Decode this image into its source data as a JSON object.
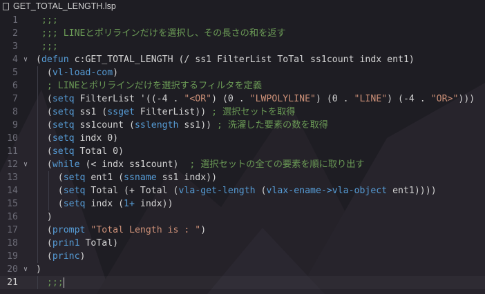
{
  "tab": {
    "filename": "GET_TOTAL_LENGTH.lsp",
    "icon": "file-icon"
  },
  "colors": {
    "background": "#1e1d23",
    "keyword": "#569cd6",
    "string": "#ce9178",
    "comment": "#6a9955",
    "text": "#d4d4d4"
  },
  "lines": [
    {
      "n": "1",
      "fold": false,
      "current": false,
      "tokens": [
        {
          "t": " ;;;",
          "c": "cm"
        }
      ]
    },
    {
      "n": "2",
      "fold": false,
      "current": false,
      "tokens": [
        {
          "t": " ;;; LINEとポリラインだけを選択し、その長さの和を返す",
          "c": "cm"
        }
      ]
    },
    {
      "n": "3",
      "fold": false,
      "current": false,
      "tokens": [
        {
          "t": " ;;;",
          "c": "cm"
        }
      ]
    },
    {
      "n": "4",
      "fold": true,
      "current": false,
      "tokens": [
        {
          "t": "(",
          "c": "par"
        },
        {
          "t": "defun",
          "c": "kw"
        },
        {
          "t": " c:GET_TOTAL_LENGTH (/ ss1 FilterList ToTal ss1count indx ent1)",
          "c": "par"
        }
      ]
    },
    {
      "n": "5",
      "fold": false,
      "current": false,
      "tokens": [
        {
          "t": "  (",
          "c": "par"
        },
        {
          "t": "vl-load-com",
          "c": "kw"
        },
        {
          "t": ")",
          "c": "par"
        }
      ]
    },
    {
      "n": "6",
      "fold": false,
      "current": false,
      "tokens": [
        {
          "t": "  ; LINEとポリラインだけを選択するフィルタを定義",
          "c": "cm"
        }
      ]
    },
    {
      "n": "7",
      "fold": false,
      "current": false,
      "tokens": [
        {
          "t": "  (",
          "c": "par"
        },
        {
          "t": "setq",
          "c": "kw"
        },
        {
          "t": " FilterList '((-4 . ",
          "c": "par"
        },
        {
          "t": "\"<OR\"",
          "c": "str"
        },
        {
          "t": ") (0 . ",
          "c": "par"
        },
        {
          "t": "\"LWPOLYLINE\"",
          "c": "str"
        },
        {
          "t": ") (0 . ",
          "c": "par"
        },
        {
          "t": "\"LINE\"",
          "c": "str"
        },
        {
          "t": ") (-4 . ",
          "c": "par"
        },
        {
          "t": "\"OR>\"",
          "c": "str"
        },
        {
          "t": ")))",
          "c": "par"
        }
      ]
    },
    {
      "n": "8",
      "fold": false,
      "current": false,
      "tokens": [
        {
          "t": "  (",
          "c": "par"
        },
        {
          "t": "setq",
          "c": "kw"
        },
        {
          "t": " ss1 (",
          "c": "par"
        },
        {
          "t": "ssget",
          "c": "kw"
        },
        {
          "t": " FilterList)) ",
          "c": "par"
        },
        {
          "t": "; 選択セットを取得",
          "c": "cm"
        }
      ]
    },
    {
      "n": "9",
      "fold": false,
      "current": false,
      "tokens": [
        {
          "t": "  (",
          "c": "par"
        },
        {
          "t": "setq",
          "c": "kw"
        },
        {
          "t": " ss1count (",
          "c": "par"
        },
        {
          "t": "sslength",
          "c": "kw"
        },
        {
          "t": " ss1)) ",
          "c": "par"
        },
        {
          "t": "; 洗濯した要素の数を取得",
          "c": "cm"
        }
      ]
    },
    {
      "n": "10",
      "fold": false,
      "current": false,
      "tokens": [
        {
          "t": "  (",
          "c": "par"
        },
        {
          "t": "setq",
          "c": "kw"
        },
        {
          "t": " indx 0)",
          "c": "par"
        }
      ]
    },
    {
      "n": "11",
      "fold": false,
      "current": false,
      "tokens": [
        {
          "t": "  (",
          "c": "par"
        },
        {
          "t": "setq",
          "c": "kw"
        },
        {
          "t": " Total 0)",
          "c": "par"
        }
      ]
    },
    {
      "n": "12",
      "fold": true,
      "current": false,
      "tokens": [
        {
          "t": "  (",
          "c": "par"
        },
        {
          "t": "while",
          "c": "kw"
        },
        {
          "t": " (< indx ss1count)  ",
          "c": "par"
        },
        {
          "t": "; 選択セットの全ての要素を順に取り出す",
          "c": "cm"
        }
      ]
    },
    {
      "n": "13",
      "fold": false,
      "current": false,
      "tokens": [
        {
          "t": "    (",
          "c": "par"
        },
        {
          "t": "setq",
          "c": "kw"
        },
        {
          "t": " ent1 (",
          "c": "par"
        },
        {
          "t": "ssname",
          "c": "kw"
        },
        {
          "t": " ss1 indx))",
          "c": "par"
        }
      ]
    },
    {
      "n": "14",
      "fold": false,
      "current": false,
      "tokens": [
        {
          "t": "    (",
          "c": "par"
        },
        {
          "t": "setq",
          "c": "kw"
        },
        {
          "t": " Total (+ Total (",
          "c": "par"
        },
        {
          "t": "vla-get-length",
          "c": "kw"
        },
        {
          "t": " (",
          "c": "par"
        },
        {
          "t": "vlax-ename->vla-object",
          "c": "kw"
        },
        {
          "t": " ent1))))",
          "c": "par"
        }
      ]
    },
    {
      "n": "15",
      "fold": false,
      "current": false,
      "tokens": [
        {
          "t": "    (",
          "c": "par"
        },
        {
          "t": "setq",
          "c": "kw"
        },
        {
          "t": " indx (",
          "c": "par"
        },
        {
          "t": "1+",
          "c": "kw"
        },
        {
          "t": " indx))",
          "c": "par"
        }
      ]
    },
    {
      "n": "16",
      "fold": false,
      "current": false,
      "tokens": [
        {
          "t": "  )",
          "c": "par"
        }
      ]
    },
    {
      "n": "17",
      "fold": false,
      "current": false,
      "tokens": [
        {
          "t": "  (",
          "c": "par"
        },
        {
          "t": "prompt",
          "c": "kw"
        },
        {
          "t": " ",
          "c": "par"
        },
        {
          "t": "\"Total Length is : \"",
          "c": "str"
        },
        {
          "t": ")",
          "c": "par"
        }
      ]
    },
    {
      "n": "18",
      "fold": false,
      "current": false,
      "tokens": [
        {
          "t": "  (",
          "c": "par"
        },
        {
          "t": "prin1",
          "c": "kw"
        },
        {
          "t": " ToTal)",
          "c": "par"
        }
      ]
    },
    {
      "n": "19",
      "fold": false,
      "current": false,
      "tokens": [
        {
          "t": "  (",
          "c": "par"
        },
        {
          "t": "princ",
          "c": "kw"
        },
        {
          "t": ")",
          "c": "par"
        }
      ]
    },
    {
      "n": "20",
      "fold": true,
      "current": false,
      "tokens": [
        {
          "t": ")",
          "c": "par"
        }
      ]
    },
    {
      "n": "21",
      "fold": false,
      "current": true,
      "tokens": [
        {
          "t": "  ;;;",
          "c": "cm"
        }
      ]
    }
  ]
}
